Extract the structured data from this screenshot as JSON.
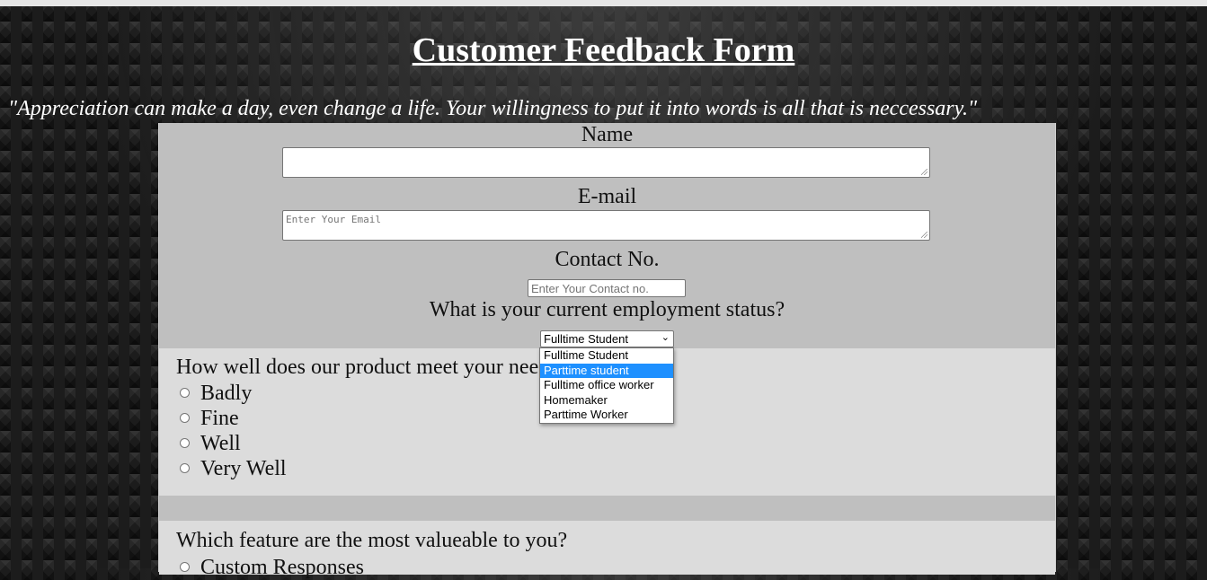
{
  "header": {
    "title": "Customer Feedback Form",
    "quote": "\"Appreciation can make a day, even change a life. Your willingness to put it into words is all that is neccessary.\""
  },
  "form": {
    "name_label": "Name",
    "name_value": "",
    "email_label": "E-mail",
    "email_placeholder": "Enter Your Email",
    "contact_label": "Contact No.",
    "contact_placeholder": "Enter Your Contact no.",
    "employment_label": "What is your current employment status?",
    "employment_selected": "Fulltime Student",
    "employment_options": [
      "Fulltime Student",
      "Parttime student",
      "Fulltime office worker",
      "Homemaker",
      "Parttime Worker"
    ],
    "employment_highlighted": "Parttime student",
    "q1_text": "How well does our product meet your needs?",
    "q1_options": [
      "Badly",
      "Fine",
      "Well",
      "Very Well"
    ],
    "q2_text": "Which feature are the most valueable to you?",
    "q2_options": [
      "Custom Responses"
    ]
  },
  "colors": {
    "form_bg": "#bfbfbf",
    "section_bg": "#dcdcdc",
    "highlight": "#1e90ff"
  }
}
